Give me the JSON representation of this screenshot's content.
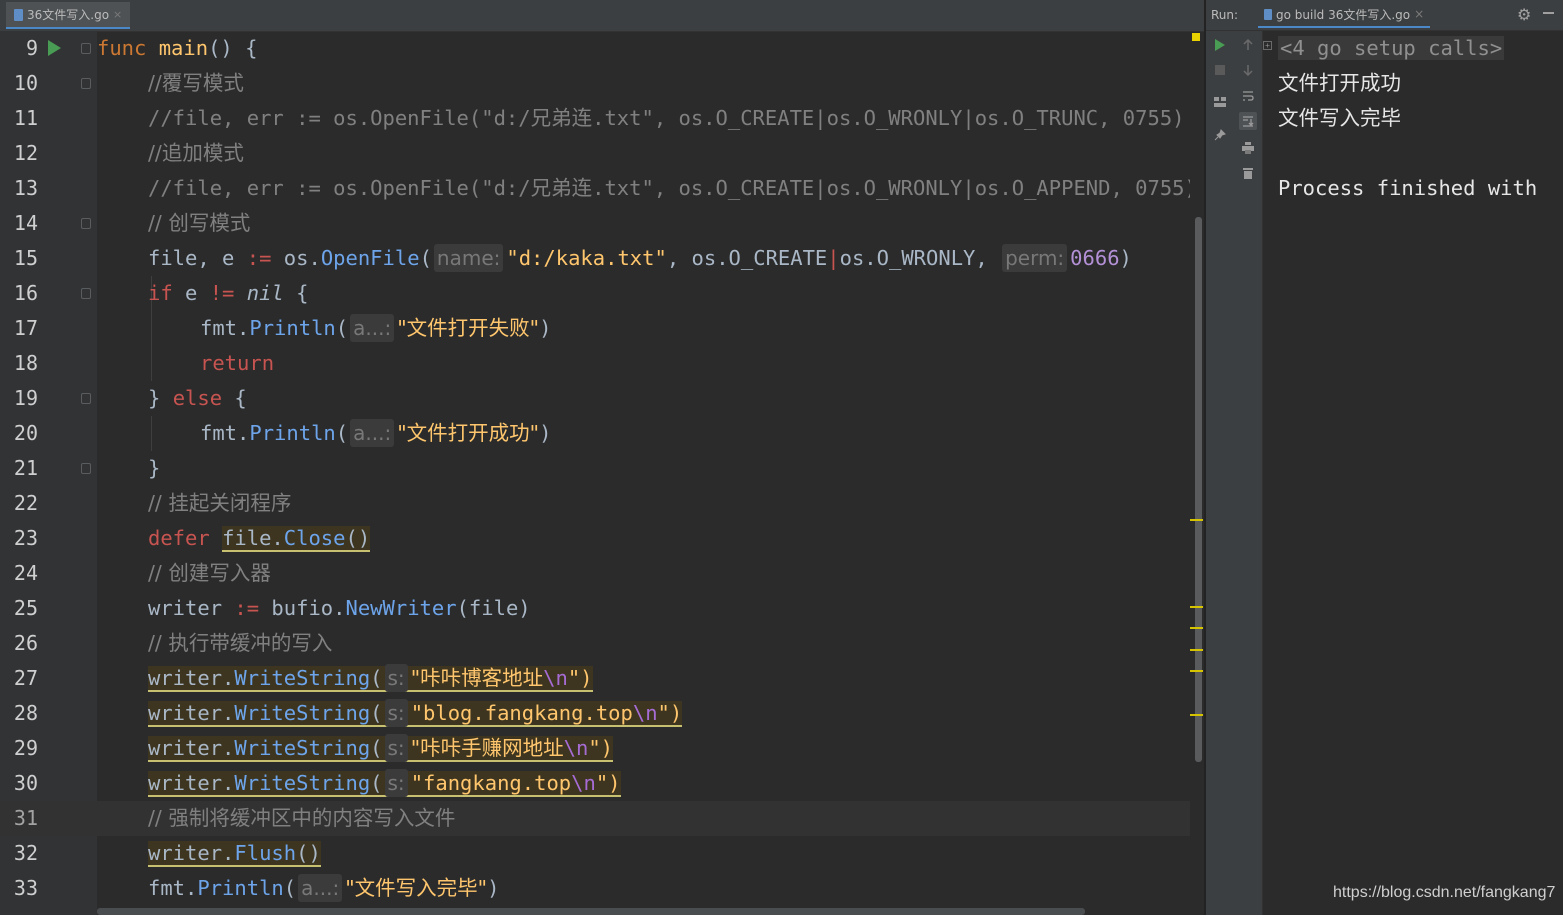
{
  "editor": {
    "tab_title": "36文件写入.go",
    "tab_close": "×",
    "line_numbers": [
      "9",
      "10",
      "11",
      "12",
      "13",
      "14",
      "15",
      "16",
      "17",
      "18",
      "19",
      "20",
      "21",
      "22",
      "23",
      "24",
      "25",
      "26",
      "27",
      "28",
      "29",
      "30",
      "31",
      "32",
      "33"
    ],
    "code": {
      "l9": {
        "kw": "func",
        "name": "main",
        "rest": "() {"
      },
      "l10": "//覆写模式",
      "l11": "//file, err := os.OpenFile(\"d:/兄弟连.txt\", os.O_CREATE|os.O_WRONLY|os.O_TRUNC, 0755)",
      "l12": "//追加模式",
      "l13": "//file, err := os.OpenFile(\"d:/兄弟连.txt\", os.O_CREATE|os.O_WRONLY|os.O_APPEND, 0755)",
      "l14": "// 创写模式",
      "l15": {
        "pre": "file, e ",
        "op": ":=",
        "mid": " os.",
        "call": "OpenFile",
        "open": "(",
        "hint1": "name:",
        "str": "\"d:/kaka.txt\"",
        "mid2": ", os.O_CREATE",
        "pipe": "|",
        "mid3": "os.O_WRONLY, ",
        "hint2": "perm:",
        "num": "0666",
        "close": ")"
      },
      "l16": {
        "kw": "if",
        "pre": " e ",
        "op": "!=",
        "nil": "nil",
        "rest": " {"
      },
      "l17": {
        "pre": "fmt.",
        "call": "Println",
        "open": "(",
        "hint": "a...:",
        "str": "\"文件打开失败\"",
        "close": ")"
      },
      "l18": "return",
      "l19": {
        "pre": "} ",
        "kw": "else",
        "rest": " {"
      },
      "l20": {
        "pre": "fmt.",
        "call": "Println",
        "open": "(",
        "hint": "a...:",
        "str": "\"文件打开成功\"",
        "close": ")"
      },
      "l21": "}",
      "l22": "// 挂起关闭程序",
      "l23": {
        "kw": "defer",
        "pre": "file.",
        "call": "Close",
        "rest": "()"
      },
      "l24": "// 创建写入器",
      "l25": {
        "pre": "writer ",
        "op": ":=",
        "mid": " bufio.",
        "call": "NewWriter",
        "rest": "(file)"
      },
      "l26": "// 执行带缓冲的写入",
      "l27": {
        "pre": "writer.",
        "call": "WriteString",
        "open": "(",
        "hint": "s:",
        "str": "\"咔咔博客地址",
        "esc": "\\n",
        "end": "\")"
      },
      "l28": {
        "pre": "writer.",
        "call": "WriteString",
        "open": "(",
        "hint": "s:",
        "str": "\"blog.fangkang.top",
        "esc": "\\n",
        "end": "\")"
      },
      "l29": {
        "pre": "writer.",
        "call": "WriteString",
        "open": "(",
        "hint": "s:",
        "str": "\"咔咔手赚网地址",
        "esc": "\\n",
        "end": "\")"
      },
      "l30": {
        "pre": "writer.",
        "call": "WriteString",
        "open": "(",
        "hint": "s:",
        "str": "\"fangkang.top",
        "esc": "\\n",
        "end": "\")"
      },
      "l31": "// 强制将缓冲区中的内容写入文件",
      "l32": {
        "pre": "writer.",
        "call": "Flush",
        "rest": "()"
      },
      "l33": {
        "pre": "fmt.",
        "call": "Println",
        "open": "(",
        "hint": "a...:",
        "str": "\"文件写入完毕\"",
        "close": ")"
      }
    }
  },
  "run_panel": {
    "label": "Run:",
    "tab_title": "go build 36文件写入.go",
    "tab_close": "×",
    "gear_icon": "⚙",
    "output": {
      "setup_calls": "<4 go setup calls>",
      "line1": "文件打开成功",
      "line2": "文件写入完毕",
      "line3": "",
      "line4": "Process finished with"
    }
  },
  "watermark": "https://blog.csdn.net/fangkang7",
  "colors": {
    "keyword": "#cc7832",
    "function": "#ffc66d",
    "comment": "#808080",
    "call": "#6da4ea",
    "background": "#2b2b2b",
    "run_green": "#499c54"
  }
}
